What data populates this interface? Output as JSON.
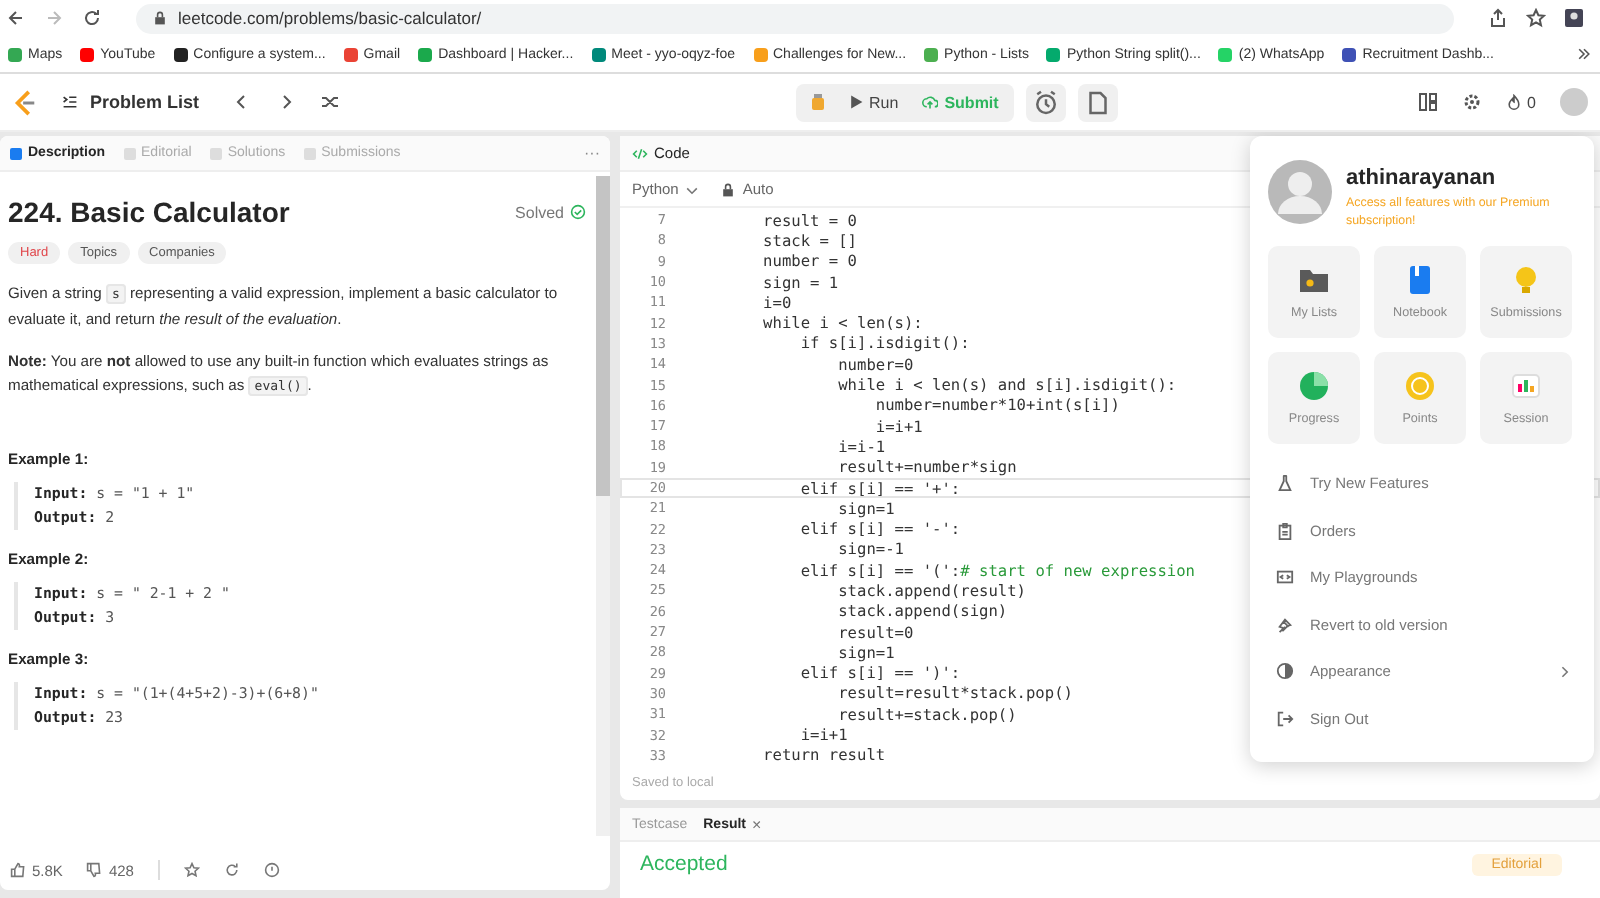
{
  "browser": {
    "url": "leetcode.com/problems/basic-calculator/",
    "bookmarks": [
      {
        "label": "Maps",
        "color": "#34a853"
      },
      {
        "label": "YouTube",
        "color": "#ff0000"
      },
      {
        "label": "Configure a system...",
        "color": "#222222"
      },
      {
        "label": "Gmail",
        "color": "#ea4335"
      },
      {
        "label": "Dashboard | Hacker...",
        "color": "#1ba94c"
      },
      {
        "label": "Meet - yyo-oqyz-foe",
        "color": "#00897b"
      },
      {
        "label": "Challenges for New...",
        "color": "#f89f1b"
      },
      {
        "label": "Python - Lists",
        "color": "#4caf50"
      },
      {
        "label": "Python String split()...",
        "color": "#04aa6d"
      },
      {
        "label": "(2) WhatsApp",
        "color": "#25d366"
      },
      {
        "label": "Recruitment Dashb...",
        "color": "#3f51b5"
      }
    ]
  },
  "nav": {
    "title": "Problem List",
    "run": "Run",
    "submit": "Submit",
    "streak": "0"
  },
  "description": {
    "tabs": [
      {
        "label": "Description",
        "selected": true
      },
      {
        "label": "Editorial",
        "selected": false
      },
      {
        "label": "Solutions",
        "selected": false
      },
      {
        "label": "Submissions",
        "selected": false
      }
    ],
    "more": "···",
    "title": "224. Basic Calculator",
    "status": "Solved",
    "difficulty": "Hard",
    "tags": [
      "Topics",
      "Companies"
    ],
    "paragraphs": [
      [
        {
          "t": "Given a string ",
          "kind": "text"
        },
        {
          "t": "s",
          "kind": "code"
        },
        {
          "t": " representing a valid expression, implement a basic calculator to evaluate it, and return ",
          "kind": "text"
        },
        {
          "t": "the result of the evaluation",
          "kind": "italic"
        },
        {
          "t": ".",
          "kind": "text"
        }
      ],
      [
        {
          "t": "Note:",
          "kind": "bold"
        },
        {
          "t": " You are ",
          "kind": "text"
        },
        {
          "t": "not",
          "kind": "bold"
        },
        {
          "t": " allowed to use any built-in function which evaluates strings as mathematical expressions, such as ",
          "kind": "text"
        },
        {
          "t": "eval()",
          "kind": "code"
        },
        {
          "t": ".",
          "kind": "text"
        }
      ]
    ],
    "examples": [
      {
        "heading": "Example 1:",
        "input_label": "Input:",
        "input": "s = \"1 + 1\"",
        "output_label": "Output:",
        "output": "2"
      },
      {
        "heading": "Example 2:",
        "input_label": "Input:",
        "input": "s = \" 2-1 + 2 \"",
        "output_label": "Output:",
        "output": "3"
      },
      {
        "heading": "Example 3:",
        "input_label": "Input:",
        "input": "s = \"(1+(4+5+2)-3)+(6+8)\"",
        "output_label": "Output:",
        "output": "23"
      }
    ],
    "likes": "5.8K",
    "dislikes": "428"
  },
  "code": {
    "tab": "Code",
    "language": "Python",
    "mode": "Auto",
    "status": "Saved to local",
    "lines": [
      {
        "number": "7",
        "text": "        result = 0",
        "current": false
      },
      {
        "number": "8",
        "text": "        stack = []",
        "current": false
      },
      {
        "number": "9",
        "text": "        number = 0",
        "current": false
      },
      {
        "number": "10",
        "text": "        sign = 1",
        "current": false
      },
      {
        "number": "11",
        "text": "        i=0",
        "current": false
      },
      {
        "number": "12",
        "text": "        while i < len(s):",
        "current": false
      },
      {
        "number": "13",
        "text": "            if s[i].isdigit():",
        "current": false
      },
      {
        "number": "14",
        "text": "                number=0",
        "current": false
      },
      {
        "number": "15",
        "text": "                while i < len(s) and s[i].isdigit():",
        "current": false
      },
      {
        "number": "16",
        "text": "                    number=number*10+int(s[i])",
        "current": false
      },
      {
        "number": "17",
        "text": "                    i=i+1",
        "current": false
      },
      {
        "number": "18",
        "text": "                i=i-1",
        "current": false
      },
      {
        "number": "19",
        "text": "                result+=number*sign",
        "current": false
      },
      {
        "number": "20",
        "text": "            elif s[i] == '+':",
        "current": true
      },
      {
        "number": "21",
        "text": "                sign=1",
        "current": false
      },
      {
        "number": "22",
        "text": "            elif s[i] == '-':",
        "current": false
      },
      {
        "number": "23",
        "text": "                sign=-1",
        "current": false
      },
      {
        "number": "24",
        "text": "            elif s[i] == '(':",
        "comment": "# start of new expression",
        "current": false
      },
      {
        "number": "25",
        "text": "                stack.append(result)",
        "current": false
      },
      {
        "number": "26",
        "text": "                stack.append(sign)",
        "current": false
      },
      {
        "number": "27",
        "text": "                result=0",
        "current": false
      },
      {
        "number": "28",
        "text": "                sign=1",
        "current": false
      },
      {
        "number": "29",
        "text": "            elif s[i] == ')':",
        "current": false
      },
      {
        "number": "30",
        "text": "                result=result*stack.pop()",
        "current": false
      },
      {
        "number": "31",
        "text": "                result+=stack.pop()",
        "current": false
      },
      {
        "number": "32",
        "text": "            i=i+1",
        "current": false
      },
      {
        "number": "33",
        "text": "        return result",
        "current": false
      }
    ]
  },
  "console": {
    "tabs": [
      {
        "label": "Testcase",
        "selected": false
      },
      {
        "label": "Result",
        "selected": true
      }
    ],
    "close": "×",
    "verdict": "Accepted",
    "editorial": "Editorial"
  },
  "menu": {
    "username": "athinarayanan",
    "premium_note": "Access all features with our Premium subscription!",
    "tiles": [
      {
        "label": "My Lists",
        "kind": "folder"
      },
      {
        "label": "Notebook",
        "kind": "notebook"
      },
      {
        "label": "Submissions",
        "kind": "bulb"
      },
      {
        "label": "Progress",
        "kind": "progress"
      },
      {
        "label": "Points",
        "kind": "coin"
      },
      {
        "label": "Session",
        "kind": "chart"
      }
    ],
    "items": [
      {
        "label": "Try New Features",
        "kind": "flask",
        "submenu": false
      },
      {
        "label": "Orders",
        "kind": "clipboard",
        "submenu": false
      },
      {
        "label": "My Playgrounds",
        "kind": "playground",
        "submenu": false
      },
      {
        "label": "Revert to old version",
        "kind": "pin",
        "submenu": false
      },
      {
        "label": "Appearance",
        "kind": "appearance",
        "submenu": true
      },
      {
        "label": "Sign Out",
        "kind": "signout",
        "submenu": false
      }
    ]
  }
}
